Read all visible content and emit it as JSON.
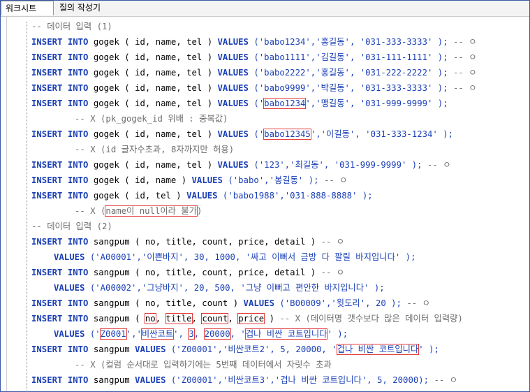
{
  "tabs": [
    "워크시트",
    "질의 작성기"
  ],
  "lines": [
    {
      "indent": 44,
      "parts": [
        {
          "t": "-- 데이터 입력 (1)",
          "c": "cm"
        }
      ]
    },
    {
      "indent": 44,
      "parts": [
        {
          "t": "INSERT INTO",
          "c": "kw"
        },
        {
          "t": " gogek ( id, name, tel ) ",
          "c": ""
        },
        {
          "t": "VALUES",
          "c": "kw"
        },
        {
          "t": " ('babo1234','홍길동', '031-333-3333' ); ",
          "c": "str"
        },
        {
          "t": "-- ㅇ",
          "c": "cm"
        }
      ]
    },
    {
      "indent": 44,
      "parts": [
        {
          "t": "INSERT INTO",
          "c": "kw"
        },
        {
          "t": " gogek ( id, name, tel ) ",
          "c": ""
        },
        {
          "t": "VALUES",
          "c": "kw"
        },
        {
          "t": " ('babo1111','김길동', '031-111-1111' ); ",
          "c": "str"
        },
        {
          "t": "-- ㅇ",
          "c": "cm"
        }
      ]
    },
    {
      "indent": 44,
      "parts": [
        {
          "t": "INSERT INTO",
          "c": "kw"
        },
        {
          "t": " gogek ( id, name, tel ) ",
          "c": ""
        },
        {
          "t": "VALUES",
          "c": "kw"
        },
        {
          "t": " ('babo2222','홍길동', '031-222-2222' ); ",
          "c": "str"
        },
        {
          "t": "-- ㅇ",
          "c": "cm"
        }
      ]
    },
    {
      "indent": 44,
      "parts": [
        {
          "t": "INSERT INTO",
          "c": "kw"
        },
        {
          "t": " gogek ( id, name, tel ) ",
          "c": ""
        },
        {
          "t": "VALUES",
          "c": "kw"
        },
        {
          "t": " ('babo9999','박길동', '031-333-3333' ); ",
          "c": "str"
        },
        {
          "t": "-- ㅇ",
          "c": "cm"
        }
      ]
    },
    {
      "indent": 44,
      "parts": [
        {
          "t": "INSERT INTO",
          "c": "kw"
        },
        {
          "t": " gogek ( id, name, tel ) ",
          "c": ""
        },
        {
          "t": "VALUES",
          "c": "kw"
        },
        {
          "t": " ('",
          "c": "str"
        },
        {
          "t": "babo1234",
          "c": "str",
          "box": true
        },
        {
          "t": "','맹길동', '031-999-9999' );",
          "c": "str"
        }
      ]
    },
    {
      "indent": 106,
      "parts": [
        {
          "t": "-- X (pk_gogek_id 위배 : 중복값)",
          "c": "cm"
        }
      ]
    },
    {
      "indent": 44,
      "parts": [
        {
          "t": "INSERT INTO",
          "c": "kw"
        },
        {
          "t": " gogek ( id, name, tel ) ",
          "c": ""
        },
        {
          "t": "VALUES",
          "c": "kw"
        },
        {
          "t": " ('",
          "c": "str"
        },
        {
          "t": "babo12345",
          "c": "str",
          "box": true
        },
        {
          "t": "','이길동', '031-333-1234' );",
          "c": "str"
        }
      ]
    },
    {
      "indent": 106,
      "parts": [
        {
          "t": "-- X (id 글자수초과, 8자까지만 허용)",
          "c": "cm"
        }
      ]
    },
    {
      "indent": 44,
      "parts": [
        {
          "t": "INSERT INTO",
          "c": "kw"
        },
        {
          "t": " gogek ( id, name, tel ) ",
          "c": ""
        },
        {
          "t": "VALUES",
          "c": "kw"
        },
        {
          "t": " ('123','최길동', '031-999-9999' ); ",
          "c": "str"
        },
        {
          "t": "-- ㅇ",
          "c": "cm"
        }
      ]
    },
    {
      "indent": 44,
      "parts": [
        {
          "t": "INSERT INTO",
          "c": "kw"
        },
        {
          "t": " gogek ( id, name ) ",
          "c": ""
        },
        {
          "t": "VALUES",
          "c": "kw"
        },
        {
          "t": " ('babo','봉길동' ); ",
          "c": "str"
        },
        {
          "t": "-- ㅇ",
          "c": "cm"
        }
      ]
    },
    {
      "indent": 44,
      "parts": [
        {
          "t": "INSERT INTO",
          "c": "kw"
        },
        {
          "t": " gogek ( id, tel ) ",
          "c": ""
        },
        {
          "t": "VALUES",
          "c": "kw"
        },
        {
          "t": " ('babo1988','031-888-8888' );",
          "c": "str"
        }
      ]
    },
    {
      "indent": 106,
      "parts": [
        {
          "t": "-- X (",
          "c": "cm"
        },
        {
          "t": "name이 null이라 불가",
          "c": "cm",
          "box": true
        },
        {
          "t": ")",
          "c": "cm"
        }
      ]
    },
    {
      "indent": 44,
      "parts": [
        {
          "t": "-- 데이터 입력 (2)",
          "c": "cm"
        }
      ]
    },
    {
      "indent": 44,
      "parts": [
        {
          "t": "INSERT INTO",
          "c": "kw"
        },
        {
          "t": " sangpum ( no, title, count, price, detail ) ",
          "c": ""
        },
        {
          "t": "-- ㅇ",
          "c": "cm"
        }
      ]
    },
    {
      "indent": 76,
      "parts": [
        {
          "t": "VALUES",
          "c": "kw"
        },
        {
          "t": " ('A00001','이쁜바지', 30, 1000, '싸고 이뻐서 금방 다 팔릴 바지입니다' );",
          "c": "str"
        }
      ]
    },
    {
      "indent": 44,
      "parts": [
        {
          "t": "INSERT INTO",
          "c": "kw"
        },
        {
          "t": " sangpum ( no, title, count, price, detail ) ",
          "c": ""
        },
        {
          "t": "-- ㅇ",
          "c": "cm"
        }
      ]
    },
    {
      "indent": 76,
      "parts": [
        {
          "t": "VALUES",
          "c": "kw"
        },
        {
          "t": " ('A00002','그냥바지', 20, 500, '그냥 이뻐고 편안한 바지입니다' );",
          "c": "str"
        }
      ]
    },
    {
      "indent": 44,
      "parts": [
        {
          "t": "INSERT INTO",
          "c": "kw"
        },
        {
          "t": " sangpum ( no, title, count ) ",
          "c": ""
        },
        {
          "t": "VALUES",
          "c": "kw"
        },
        {
          "t": " ('B00009','윗도리', 20 ); ",
          "c": "str"
        },
        {
          "t": "-- ㅇ",
          "c": "cm"
        }
      ]
    },
    {
      "indent": 44,
      "parts": [
        {
          "t": "INSERT INTO",
          "c": "kw"
        },
        {
          "t": " sangpum ( ",
          "c": ""
        },
        {
          "t": "no",
          "c": "",
          "box": true
        },
        {
          "t": ", ",
          "c": ""
        },
        {
          "t": "title",
          "c": "",
          "box": true
        },
        {
          "t": ", ",
          "c": ""
        },
        {
          "t": "count",
          "c": "",
          "box": true
        },
        {
          "t": ", ",
          "c": ""
        },
        {
          "t": "price",
          "c": "",
          "box": true
        },
        {
          "t": " ) ",
          "c": ""
        },
        {
          "t": "-- X (데이터명 갯수보다 많은 데이터 입력량)",
          "c": "cm"
        }
      ]
    },
    {
      "indent": 76,
      "parts": [
        {
          "t": "VALUES",
          "c": "kw"
        },
        {
          "t": " ('",
          "c": "str"
        },
        {
          "t": "Z0001",
          "c": "str",
          "box": true
        },
        {
          "t": "','",
          "c": "str"
        },
        {
          "t": "비싼코트",
          "c": "str",
          "box": true
        },
        {
          "t": "', ",
          "c": "str"
        },
        {
          "t": "3",
          "c": "str",
          "box": true
        },
        {
          "t": ", ",
          "c": "str"
        },
        {
          "t": "20000",
          "c": "str",
          "box": true
        },
        {
          "t": ", '",
          "c": "str"
        },
        {
          "t": "겁나 비싼 코트입니다",
          "c": "str",
          "box": true
        },
        {
          "t": "' );",
          "c": "str"
        }
      ]
    },
    {
      "indent": 44,
      "parts": [
        {
          "t": "INSERT INTO",
          "c": "kw"
        },
        {
          "t": " sangpum ",
          "c": ""
        },
        {
          "t": "VALUES",
          "c": "kw"
        },
        {
          "t": " ('Z00001','비싼코트2', 5, 20000, '",
          "c": "str"
        },
        {
          "t": "겁나 비싼 코트입니다",
          "c": "str",
          "box": true
        },
        {
          "t": "' );",
          "c": "str"
        }
      ]
    },
    {
      "indent": 106,
      "parts": [
        {
          "t": "-- X (컬럼 순서대로 입력하기에는 5번째 데이터에서 자릿수 초과",
          "c": "cm"
        }
      ]
    },
    {
      "indent": 44,
      "parts": [
        {
          "t": "INSERT INTO",
          "c": "kw"
        },
        {
          "t": " sangpum ",
          "c": ""
        },
        {
          "t": "VALUES",
          "c": "kw"
        },
        {
          "t": " ('Z00001','비싼코트3','겁나 비싼 코트입니다', 5, 20000); ",
          "c": "str"
        },
        {
          "t": "-- ㅇ",
          "c": "cm"
        }
      ]
    }
  ]
}
